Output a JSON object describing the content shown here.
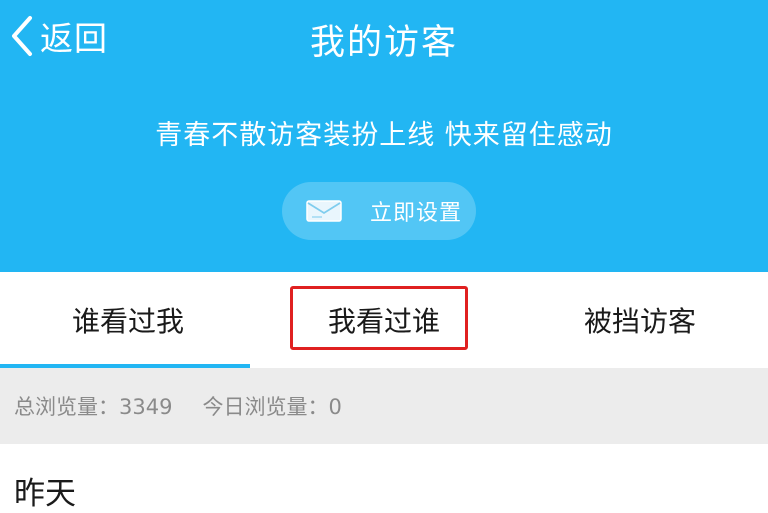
{
  "header": {
    "back_label": "返回",
    "title": "我的访客",
    "promo_text": "青春不散访客装扮上线 快来留住感动",
    "set_button_label": "立即设置",
    "bg_color": "#22b6f3"
  },
  "tabs": [
    {
      "label": "谁看过我",
      "selected": true
    },
    {
      "label": "我看过谁",
      "selected": false,
      "highlighted": true
    },
    {
      "label": "被挡访客",
      "selected": false
    }
  ],
  "stats": {
    "total_label": "总浏览量：3349",
    "today_label": "今日浏览量：0"
  },
  "section": {
    "label": "昨天"
  },
  "colors": {
    "accent": "#22b6f3",
    "highlight": "#e02020"
  }
}
